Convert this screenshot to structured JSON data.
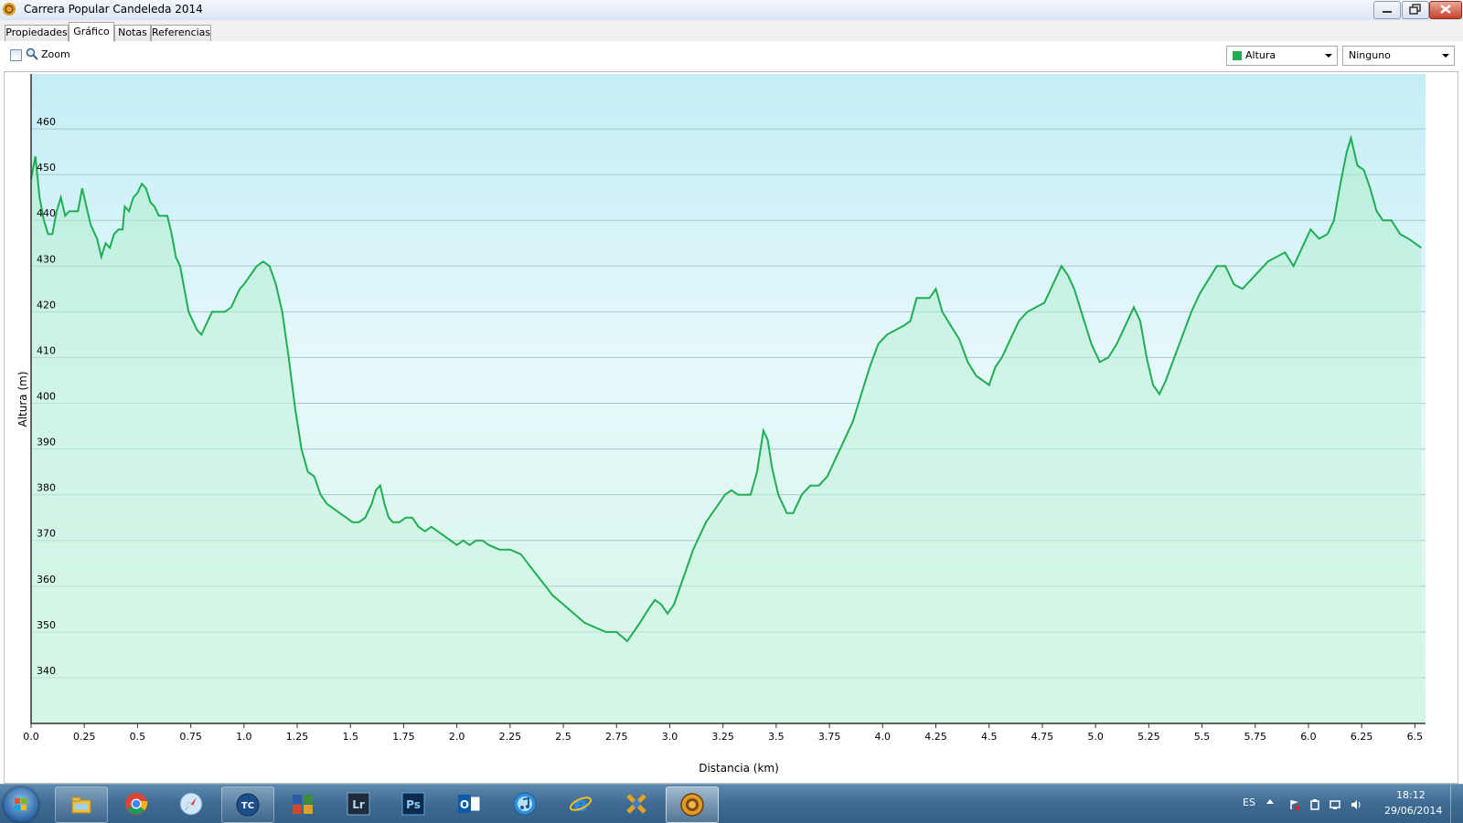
{
  "window": {
    "title": "Carrera Popular Candeleda 2014"
  },
  "tabs": [
    {
      "label": "Propiedades",
      "active": false
    },
    {
      "label": "Gráfico",
      "active": true
    },
    {
      "label": "Notas",
      "active": false
    },
    {
      "label": "Referencias",
      "active": false
    }
  ],
  "toolbar": {
    "zoom_label": "Zoom",
    "series_combo": {
      "selected": "Altura",
      "color": "#1fae52"
    },
    "second_combo": {
      "selected": "Ninguno"
    }
  },
  "chart_data": {
    "type": "area",
    "xlabel": "Distancia (km)",
    "ylabel": "Altura (m)",
    "xlim": [
      0,
      6.55
    ],
    "ylim": [
      330,
      472
    ],
    "x_ticks": [
      "0.0",
      "0.25",
      "0.5",
      "0.75",
      "1.0",
      "1.25",
      "1.5",
      "1.75",
      "2.0",
      "2.25",
      "2.5",
      "2.75",
      "3.0",
      "3.25",
      "3.5",
      "3.75",
      "4.0",
      "4.25",
      "4.5",
      "4.75",
      "5.0",
      "5.25",
      "5.5",
      "5.75",
      "6.0",
      "6.25",
      "6.5"
    ],
    "y_ticks": [
      "340",
      "350",
      "360",
      "370",
      "380",
      "390",
      "400",
      "410",
      "420",
      "430",
      "440",
      "450",
      "460"
    ],
    "grid": true,
    "line_color": "#1fae52",
    "fill_color": "#c6f1dc",
    "series": [
      {
        "values": [
          [
            0.0,
            449
          ],
          [
            0.02,
            454
          ],
          [
            0.04,
            445
          ],
          [
            0.06,
            440
          ],
          [
            0.08,
            437
          ],
          [
            0.1,
            437
          ],
          [
            0.12,
            442
          ],
          [
            0.14,
            445
          ],
          [
            0.16,
            441
          ],
          [
            0.18,
            442
          ],
          [
            0.22,
            442
          ],
          [
            0.24,
            447
          ],
          [
            0.26,
            443
          ],
          [
            0.28,
            439
          ],
          [
            0.31,
            436
          ],
          [
            0.33,
            432
          ],
          [
            0.35,
            435
          ],
          [
            0.37,
            434
          ],
          [
            0.39,
            437
          ],
          [
            0.41,
            438
          ],
          [
            0.43,
            438
          ],
          [
            0.44,
            443
          ],
          [
            0.46,
            442
          ],
          [
            0.48,
            445
          ],
          [
            0.5,
            446
          ],
          [
            0.52,
            448
          ],
          [
            0.54,
            447
          ],
          [
            0.56,
            444
          ],
          [
            0.58,
            443
          ],
          [
            0.6,
            441
          ],
          [
            0.64,
            441
          ],
          [
            0.66,
            437
          ],
          [
            0.68,
            432
          ],
          [
            0.7,
            430
          ],
          [
            0.72,
            425
          ],
          [
            0.74,
            420
          ],
          [
            0.76,
            418
          ],
          [
            0.78,
            416
          ],
          [
            0.8,
            415
          ],
          [
            0.82,
            417
          ],
          [
            0.85,
            420
          ],
          [
            0.88,
            420
          ],
          [
            0.91,
            420
          ],
          [
            0.94,
            421
          ],
          [
            0.96,
            423
          ],
          [
            0.98,
            425
          ],
          [
            1.0,
            426
          ],
          [
            1.03,
            428
          ],
          [
            1.06,
            430
          ],
          [
            1.09,
            431
          ],
          [
            1.12,
            430
          ],
          [
            1.15,
            426
          ],
          [
            1.18,
            420
          ],
          [
            1.21,
            410
          ],
          [
            1.24,
            399
          ],
          [
            1.27,
            390
          ],
          [
            1.3,
            385
          ],
          [
            1.33,
            384
          ],
          [
            1.36,
            380
          ],
          [
            1.39,
            378
          ],
          [
            1.42,
            377
          ],
          [
            1.45,
            376
          ],
          [
            1.48,
            375
          ],
          [
            1.51,
            374
          ],
          [
            1.54,
            374
          ],
          [
            1.57,
            375
          ],
          [
            1.6,
            378
          ],
          [
            1.62,
            381
          ],
          [
            1.64,
            382
          ],
          [
            1.66,
            378
          ],
          [
            1.68,
            375
          ],
          [
            1.7,
            374
          ],
          [
            1.73,
            374
          ],
          [
            1.76,
            375
          ],
          [
            1.79,
            375
          ],
          [
            1.82,
            373
          ],
          [
            1.85,
            372
          ],
          [
            1.88,
            373
          ],
          [
            1.91,
            372
          ],
          [
            1.94,
            371
          ],
          [
            1.97,
            370
          ],
          [
            2.0,
            369
          ],
          [
            2.03,
            370
          ],
          [
            2.06,
            369
          ],
          [
            2.09,
            370
          ],
          [
            2.12,
            370
          ],
          [
            2.15,
            369
          ],
          [
            2.2,
            368
          ],
          [
            2.25,
            368
          ],
          [
            2.3,
            367
          ],
          [
            2.35,
            364
          ],
          [
            2.4,
            361
          ],
          [
            2.45,
            358
          ],
          [
            2.5,
            356
          ],
          [
            2.55,
            354
          ],
          [
            2.6,
            352
          ],
          [
            2.65,
            351
          ],
          [
            2.7,
            350
          ],
          [
            2.75,
            350
          ],
          [
            2.8,
            348
          ],
          [
            2.83,
            350
          ],
          [
            2.86,
            352
          ],
          [
            2.9,
            355
          ],
          [
            2.93,
            357
          ],
          [
            2.96,
            356
          ],
          [
            2.99,
            354
          ],
          [
            3.02,
            356
          ],
          [
            3.05,
            360
          ],
          [
            3.08,
            364
          ],
          [
            3.11,
            368
          ],
          [
            3.14,
            371
          ],
          [
            3.17,
            374
          ],
          [
            3.2,
            376
          ],
          [
            3.23,
            378
          ],
          [
            3.26,
            380
          ],
          [
            3.29,
            381
          ],
          [
            3.32,
            380
          ],
          [
            3.35,
            380
          ],
          [
            3.38,
            380
          ],
          [
            3.41,
            385
          ],
          [
            3.44,
            394
          ],
          [
            3.46,
            392
          ],
          [
            3.48,
            386
          ],
          [
            3.51,
            380
          ],
          [
            3.55,
            376
          ],
          [
            3.58,
            376
          ],
          [
            3.62,
            380
          ],
          [
            3.66,
            382
          ],
          [
            3.7,
            382
          ],
          [
            3.74,
            384
          ],
          [
            3.78,
            388
          ],
          [
            3.82,
            392
          ],
          [
            3.86,
            396
          ],
          [
            3.9,
            402
          ],
          [
            3.94,
            408
          ],
          [
            3.98,
            413
          ],
          [
            4.02,
            415
          ],
          [
            4.06,
            416
          ],
          [
            4.1,
            417
          ],
          [
            4.13,
            418
          ],
          [
            4.16,
            423
          ],
          [
            4.19,
            423
          ],
          [
            4.22,
            423
          ],
          [
            4.25,
            425
          ],
          [
            4.28,
            420
          ],
          [
            4.32,
            417
          ],
          [
            4.36,
            414
          ],
          [
            4.4,
            409
          ],
          [
            4.44,
            406
          ],
          [
            4.47,
            405
          ],
          [
            4.5,
            404
          ],
          [
            4.53,
            408
          ],
          [
            4.56,
            410
          ],
          [
            4.6,
            414
          ],
          [
            4.64,
            418
          ],
          [
            4.68,
            420
          ],
          [
            4.72,
            421
          ],
          [
            4.76,
            422
          ],
          [
            4.8,
            426
          ],
          [
            4.84,
            430
          ],
          [
            4.87,
            428
          ],
          [
            4.9,
            425
          ],
          [
            4.94,
            419
          ],
          [
            4.98,
            413
          ],
          [
            5.02,
            409
          ],
          [
            5.06,
            410
          ],
          [
            5.1,
            413
          ],
          [
            5.14,
            417
          ],
          [
            5.18,
            421
          ],
          [
            5.21,
            418
          ],
          [
            5.24,
            410
          ],
          [
            5.27,
            404
          ],
          [
            5.3,
            402
          ],
          [
            5.33,
            405
          ],
          [
            5.37,
            410
          ],
          [
            5.41,
            415
          ],
          [
            5.45,
            420
          ],
          [
            5.49,
            424
          ],
          [
            5.53,
            427
          ],
          [
            5.57,
            430
          ],
          [
            5.61,
            430
          ],
          [
            5.65,
            426
          ],
          [
            5.69,
            425
          ],
          [
            5.73,
            427
          ],
          [
            5.77,
            429
          ],
          [
            5.81,
            431
          ],
          [
            5.85,
            432
          ],
          [
            5.89,
            433
          ],
          [
            5.93,
            430
          ],
          [
            5.97,
            434
          ],
          [
            6.01,
            438
          ],
          [
            6.05,
            436
          ],
          [
            6.09,
            437
          ],
          [
            6.12,
            440
          ],
          [
            6.15,
            448
          ],
          [
            6.18,
            455
          ],
          [
            6.2,
            458
          ],
          [
            6.23,
            452
          ],
          [
            6.26,
            451
          ],
          [
            6.29,
            447
          ],
          [
            6.32,
            442
          ],
          [
            6.35,
            440
          ],
          [
            6.39,
            440
          ],
          [
            6.43,
            437
          ],
          [
            6.47,
            436
          ],
          [
            6.5,
            435
          ],
          [
            6.53,
            434
          ]
        ]
      }
    ]
  },
  "taskbar": {
    "apps": [
      {
        "name": "explorer-icon",
        "pinned": true
      },
      {
        "name": "chrome-icon",
        "pinned": false
      },
      {
        "name": "safari-icon",
        "pinned": false
      },
      {
        "name": "tc-icon",
        "pinned": true,
        "label": "TC"
      },
      {
        "name": "office-icon",
        "pinned": false
      },
      {
        "name": "lightroom-icon",
        "pinned": false,
        "label": "Lr"
      },
      {
        "name": "photoshop-icon",
        "pinned": false,
        "label": "Ps"
      },
      {
        "name": "outlook-icon",
        "pinned": false,
        "label": "O"
      },
      {
        "name": "itunes-icon",
        "pinned": false
      },
      {
        "name": "ie-icon",
        "pinned": false
      },
      {
        "name": "tools-icon",
        "pinned": false
      },
      {
        "name": "gps-app-icon",
        "pinned": true
      }
    ],
    "language": "ES",
    "time": "18:12",
    "date": "29/06/2014"
  }
}
